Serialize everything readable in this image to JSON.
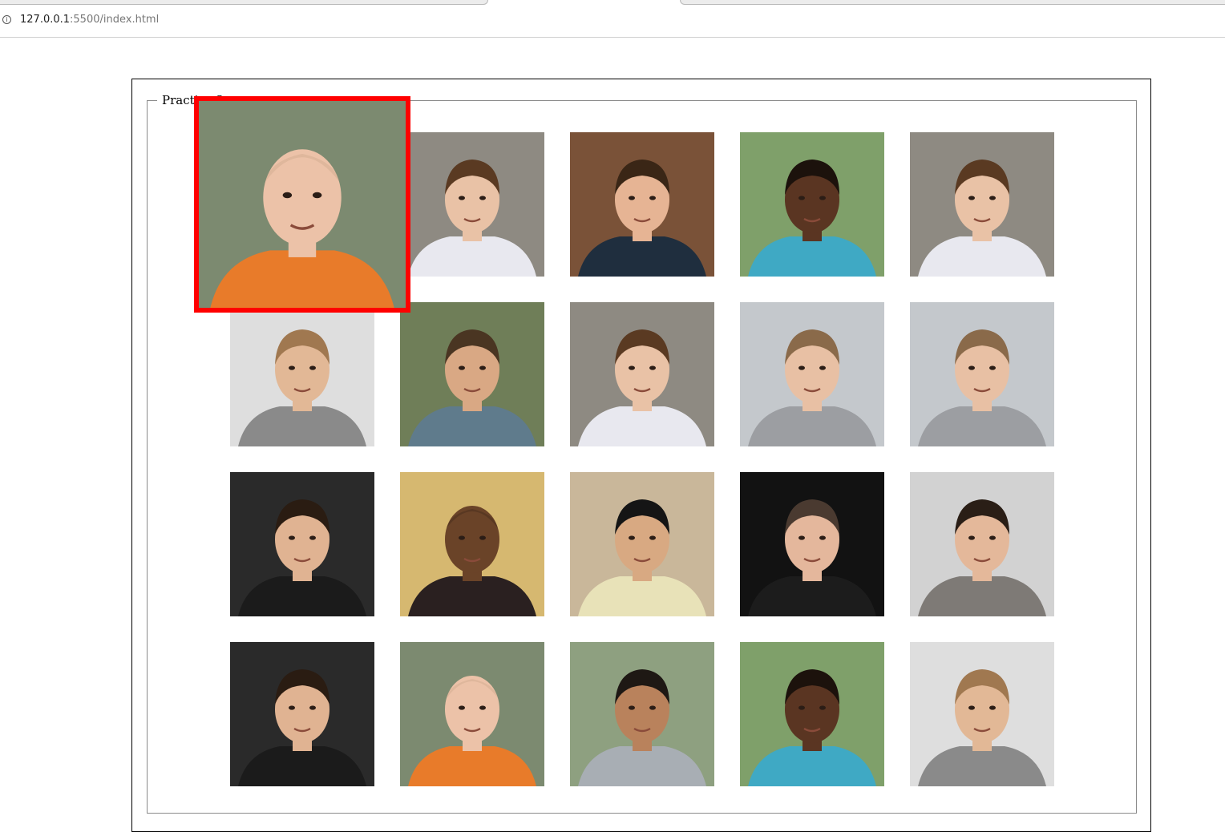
{
  "browser": {
    "url_host": "127.0.0.1",
    "url_rest": ":5500/index.html",
    "info_icon": "info-icon"
  },
  "fieldset": {
    "legend": "Practice 3"
  },
  "tiles": [
    {
      "name": "photo-empty-slot",
      "bg": "#ffffff",
      "skin": "",
      "hair": "",
      "shirt": "",
      "bald": false
    },
    {
      "name": "photo-young-man-white-shirt",
      "bg": "#8e8a82",
      "skin": "#e9c2a6",
      "hair": "#5a3a22",
      "shirt": "#e8e8ef",
      "bald": false
    },
    {
      "name": "photo-man-wood-background",
      "bg": "#7a5238",
      "skin": "#e6b494",
      "hair": "#3a2616",
      "shirt": "#1f2e3e",
      "bald": false
    },
    {
      "name": "photo-man-park-teal-shirt",
      "bg": "#7fa06a",
      "skin": "#5a3522",
      "hair": "#1c120c",
      "shirt": "#3fa9c4",
      "bald": false
    },
    {
      "name": "photo-young-man-white-shirt",
      "bg": "#8e8a82",
      "skin": "#e9c2a6",
      "hair": "#5a3a22",
      "shirt": "#e8e8ef",
      "bald": false
    },
    {
      "name": "photo-man-glasses-plaid",
      "bg": "#dedede",
      "skin": "#e2b896",
      "hair": "#a07850",
      "shirt": "#8a8a8a",
      "bald": false
    },
    {
      "name": "photo-man-smiling-outdoors",
      "bg": "#6f7e58",
      "skin": "#d9a884",
      "hair": "#4a3522",
      "shirt": "#5f7b8c",
      "bald": false
    },
    {
      "name": "photo-young-man-white-shirt",
      "bg": "#8e8a82",
      "skin": "#e9c2a6",
      "hair": "#5a3a22",
      "shirt": "#e8e8ef",
      "bald": false
    },
    {
      "name": "photo-man-beach-huts",
      "bg": "#c4c8cc",
      "skin": "#e8c0a4",
      "hair": "#8a6a4a",
      "shirt": "#9c9ea2",
      "bald": false
    },
    {
      "name": "photo-man-beach-huts",
      "bg": "#c4c8cc",
      "skin": "#e8c0a4",
      "hair": "#8a6a4a",
      "shirt": "#9c9ea2",
      "bald": false
    },
    {
      "name": "photo-man-dark-studio",
      "bg": "#2a2a2a",
      "skin": "#e0b392",
      "hair": "#2a1c12",
      "shirt": "#1b1b1b",
      "bald": false
    },
    {
      "name": "photo-man-selfie-bald",
      "bg": "#d6b870",
      "skin": "#6a4328",
      "hair": "#3a2416",
      "shirt": "#2a2020",
      "bald": true
    },
    {
      "name": "photo-man-glasses-striped",
      "bg": "#c9b79a",
      "skin": "#d8a982",
      "hair": "#151515",
      "shirt": "#e8e2b8",
      "bald": false
    },
    {
      "name": "photo-man-dark-jacket",
      "bg": "#121212",
      "skin": "#e4b79c",
      "hair": "#4a3a30",
      "shirt": "#1c1c1c",
      "bald": false
    },
    {
      "name": "photo-man-grey-shirt",
      "bg": "#d2d2d2",
      "skin": "#e4b89a",
      "hair": "#2a1e16",
      "shirt": "#7e7a76",
      "bald": false
    },
    {
      "name": "photo-man-dark-studio",
      "bg": "#2a2a2a",
      "skin": "#e0b392",
      "hair": "#2a1c12",
      "shirt": "#1b1b1b",
      "bald": false
    },
    {
      "name": "photo-bald-man-orange-vest",
      "bg": "#7c8a70",
      "skin": "#ecc2a8",
      "hair": "#c9a488",
      "shirt": "#e87b2a",
      "bald": true
    },
    {
      "name": "photo-man-grey-sweater",
      "bg": "#8ea080",
      "skin": "#b9825c",
      "hair": "#1e1814",
      "shirt": "#a8aeb4",
      "bald": false
    },
    {
      "name": "photo-man-park-teal-shirt",
      "bg": "#7fa06a",
      "skin": "#5a3522",
      "hair": "#1c120c",
      "shirt": "#3fa9c4",
      "bald": false
    },
    {
      "name": "photo-man-glasses-plaid",
      "bg": "#dedede",
      "skin": "#e2b896",
      "hair": "#a07850",
      "shirt": "#8a8a8a",
      "bald": false
    }
  ],
  "zoom": {
    "name": "zoomed-photo-bald-man",
    "bg": "#7c8a70",
    "skin": "#ecc2a8",
    "hair": "#c9a488",
    "shirt": "#e87b2a",
    "bald": true,
    "border_color": "#ff0000"
  }
}
